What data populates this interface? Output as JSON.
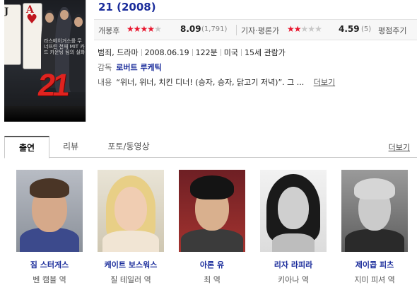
{
  "movie": {
    "title": "21 (2008)",
    "poster_title": "21",
    "poster_tagline": "라스베이거스를 무너뜨린 천재 MIT 카드 카운팅 팀의 실화"
  },
  "ratings": {
    "audience_label": "개봉후",
    "audience_score": "8.09",
    "audience_count": "(1,791)",
    "audience_stars": 4,
    "critic_label": "기자·평론가",
    "critic_score": "4.59",
    "critic_count": "(5)",
    "critic_stars": 2.3,
    "rate_button": "평점주기"
  },
  "info": {
    "genre": "범죄, 드라마",
    "release_date": "2008.06.19",
    "runtime": "122분",
    "country": "미국",
    "age_rating": "15세 관람가",
    "director_label": "감독",
    "director": "로버트 루케틱",
    "synopsis_label": "내용",
    "synopsis": "“위너, 위너, 치킨 디너! (승자, 승자, 닭고기 저녁)”. 그 ...",
    "more_label": "더보기"
  },
  "tabs": {
    "items": [
      {
        "label": "출연"
      },
      {
        "label": "리뷰"
      },
      {
        "label": "포토/동영상"
      }
    ],
    "more_label": "더보기"
  },
  "cast": [
    {
      "name": "짐 스터게스",
      "role": "벤 캠블 역"
    },
    {
      "name": "케이트 보스워스",
      "role": "질 테일러 역"
    },
    {
      "name": "아론 유",
      "role": "최 역"
    },
    {
      "name": "리자 라피라",
      "role": "키아나 역"
    },
    {
      "name": "제이콥 피츠",
      "role": "지미 피셔 역"
    }
  ],
  "colors": {
    "link_blue": "#1a2c9b",
    "star_red": "#e8152d",
    "star_grey": "#c8c8c8"
  }
}
